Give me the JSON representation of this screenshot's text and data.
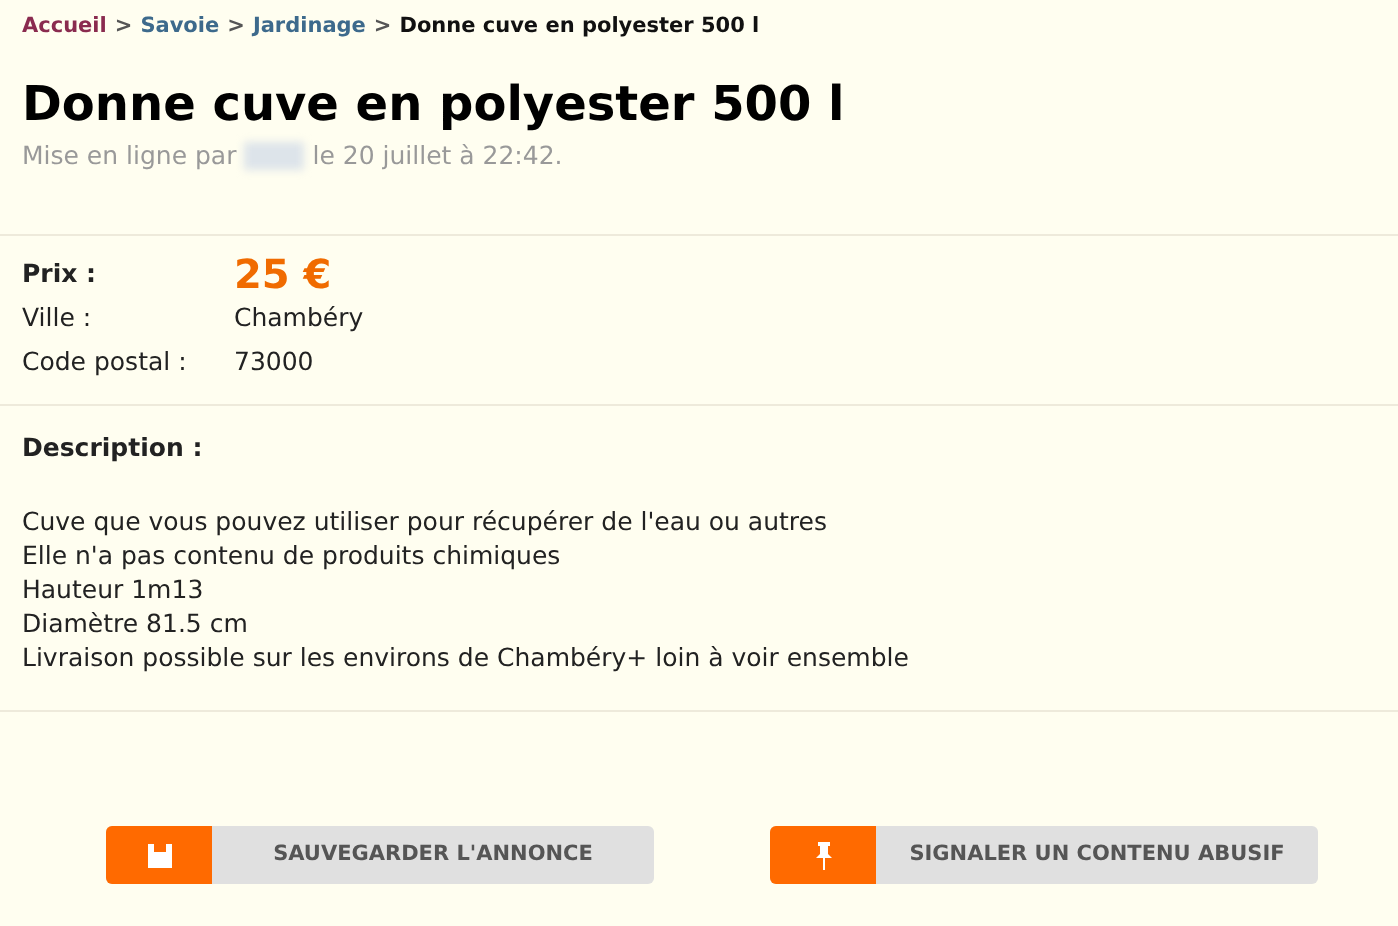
{
  "breadcrumb": [
    {
      "label": "Accueil",
      "kind": "home"
    },
    {
      "label": "Savoie",
      "kind": "link"
    },
    {
      "label": "Jardinage",
      "kind": "link"
    },
    {
      "label": "Donne cuve en polyester 500 l",
      "kind": "current"
    }
  ],
  "breadcrumb_separator": ">",
  "title": "Donne cuve en polyester 500 l",
  "posted": {
    "prefix": "Mise en ligne par",
    "suffix": "le 20 juillet à 22:42."
  },
  "details": [
    {
      "label": "Prix :",
      "value": "25 €",
      "kind": "price"
    },
    {
      "label": "Ville :",
      "value": "Chambéry",
      "kind": "plain"
    },
    {
      "label": "Code postal :",
      "value": "73000",
      "kind": "plain"
    }
  ],
  "description": {
    "label": "Description :",
    "lines": [
      "Cuve que vous pouvez utiliser pour récupérer de l'eau ou autres",
      "Elle n'a pas contenu de produits chimiques",
      "Hauteur 1m13",
      "Diamètre 81.5 cm",
      "Livraison possible sur les environs de Chambéry+ loin à voir ensemble"
    ]
  },
  "buttons": [
    {
      "label": "SAUVEGARDER L'ANNONCE",
      "kind": "save"
    },
    {
      "label": "SIGNALER UN CONTENU ABUSIF",
      "kind": "report"
    }
  ]
}
